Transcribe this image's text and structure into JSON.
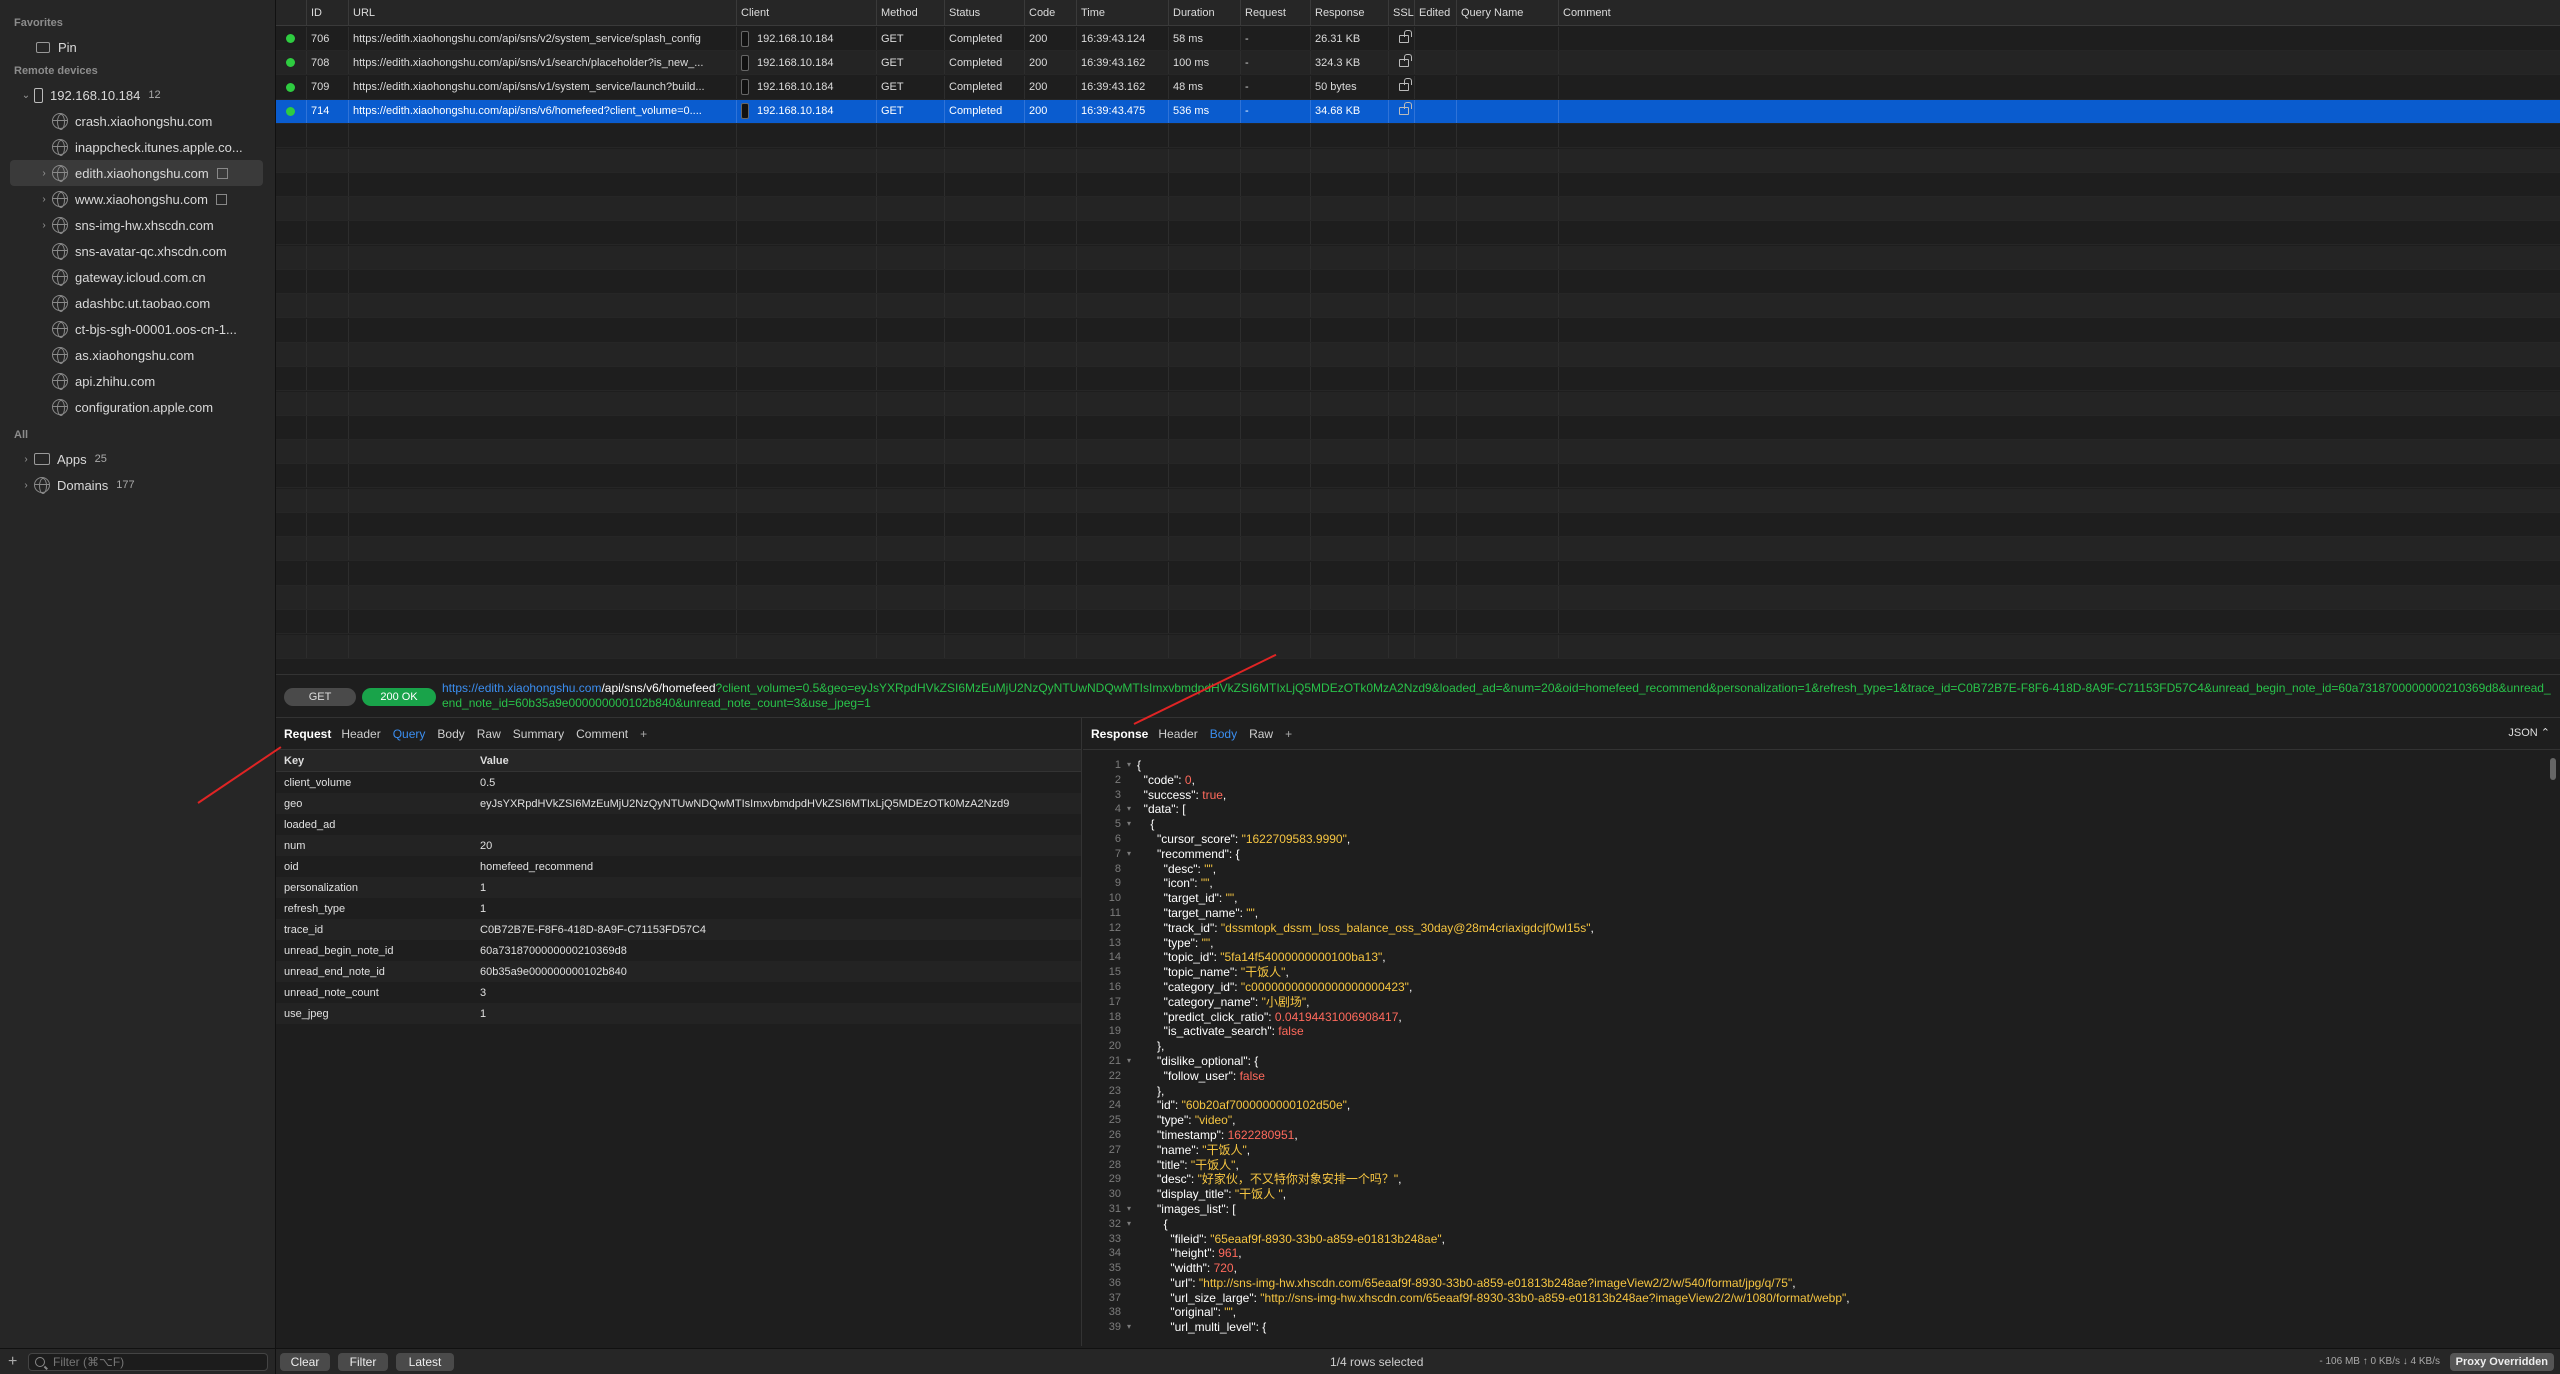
{
  "sidebar": {
    "favorites_label": "Favorites",
    "pin_label": "Pin",
    "remote_label": "Remote devices",
    "device": {
      "name": "192.168.10.184",
      "count": "12"
    },
    "domains": [
      {
        "name": "crash.xiaohongshu.com",
        "expandable": false,
        "selected": false,
        "external": false
      },
      {
        "name": "inappcheck.itunes.apple.co...",
        "expandable": false,
        "selected": false,
        "external": false
      },
      {
        "name": "edith.xiaohongshu.com",
        "expandable": true,
        "selected": true,
        "external": true
      },
      {
        "name": "www.xiaohongshu.com",
        "expandable": true,
        "selected": false,
        "external": true
      },
      {
        "name": "sns-img-hw.xhscdn.com",
        "expandable": true,
        "selected": false,
        "external": false
      },
      {
        "name": "sns-avatar-qc.xhscdn.com",
        "expandable": false,
        "selected": false,
        "external": false
      },
      {
        "name": "gateway.icloud.com.cn",
        "expandable": false,
        "selected": false,
        "external": false
      },
      {
        "name": "adashbc.ut.taobao.com",
        "expandable": false,
        "selected": false,
        "external": false
      },
      {
        "name": "ct-bjs-sgh-00001.oos-cn-1...",
        "expandable": false,
        "selected": false,
        "external": false
      },
      {
        "name": "as.xiaohongshu.com",
        "expandable": false,
        "selected": false,
        "external": false
      },
      {
        "name": "api.zhihu.com",
        "expandable": false,
        "selected": false,
        "external": false
      },
      {
        "name": "configuration.apple.com",
        "expandable": false,
        "selected": false,
        "external": false
      }
    ],
    "all_label": "All",
    "apps": {
      "label": "Apps",
      "count": "25"
    },
    "domains_group": {
      "label": "Domains",
      "count": "177"
    },
    "filter_placeholder": "Filter (⌘⌥F)"
  },
  "table": {
    "columns": [
      "ID",
      "URL",
      "Client",
      "Method",
      "Status",
      "Code",
      "Time",
      "Duration",
      "Request",
      "Response",
      "SSL",
      "Edited",
      "Query Name",
      "Comment"
    ],
    "rows": [
      {
        "id": "706",
        "url": "https://edith.xiaohongshu.com/api/sns/v2/system_service/splash_config",
        "client": "192.168.10.184",
        "method": "GET",
        "status": "Completed",
        "code": "200",
        "time": "16:39:43.124",
        "duration": "58 ms",
        "request": "-",
        "response": "26.31 KB"
      },
      {
        "id": "708",
        "url": "https://edith.xiaohongshu.com/api/sns/v1/search/placeholder?is_new_...",
        "client": "192.168.10.184",
        "method": "GET",
        "status": "Completed",
        "code": "200",
        "time": "16:39:43.162",
        "duration": "100 ms",
        "request": "-",
        "response": "324.3 KB"
      },
      {
        "id": "709",
        "url": "https://edith.xiaohongshu.com/api/sns/v1/system_service/launch?build...",
        "client": "192.168.10.184",
        "method": "GET",
        "status": "Completed",
        "code": "200",
        "time": "16:39:43.162",
        "duration": "48 ms",
        "request": "-",
        "response": "50 bytes"
      },
      {
        "id": "714",
        "url": "https://edith.xiaohongshu.com/api/sns/v6/homefeed?client_volume=0....",
        "client": "192.168.10.184",
        "method": "GET",
        "status": "Completed",
        "code": "200",
        "time": "16:39:43.475",
        "duration": "536 ms",
        "request": "-",
        "response": "34.68 KB"
      }
    ]
  },
  "urlbar": {
    "method": "GET",
    "status": "200 OK",
    "scheme_host": "https://edith.xiaohongshu.com",
    "path": "/api/sns/v6/homefeed",
    "query": "?client_volume=0.5&geo=eyJsYXRpdHVkZSI6MzEuMjU2NzQyNTUwNDQwMTIsImxvbmdpdHVkZSI6MTIxLjQ5MDEzOTk0MzA2Nzd9&loaded_ad=&num=20&oid=homefeed_recommend&personalization=1&refresh_type=1&trace_id=C0B72B7E-F8F6-418D-8A9F-C71153FD57C4&unread_begin_note_id=60a7318700000000210369d8&unread_end_note_id=60b35a9e000000000102b840&unread_note_count=3&use_jpeg=1"
  },
  "request_pane": {
    "title": "Request",
    "tabs": [
      "Header",
      "Query",
      "Body",
      "Raw",
      "Summary",
      "Comment"
    ],
    "active_tab": "Query",
    "key_header": "Key",
    "value_header": "Value",
    "params": [
      {
        "key": "client_volume",
        "value": "0.5"
      },
      {
        "key": "geo",
        "value": "eyJsYXRpdHVkZSI6MzEuMjU2NzQyNTUwNDQwMTIsImxvbmdpdHVkZSI6MTIxLjQ5MDEzOTk0MzA2Nzd9"
      },
      {
        "key": "loaded_ad",
        "value": ""
      },
      {
        "key": "num",
        "value": "20"
      },
      {
        "key": "oid",
        "value": "homefeed_recommend"
      },
      {
        "key": "personalization",
        "value": "1"
      },
      {
        "key": "refresh_type",
        "value": "1"
      },
      {
        "key": "trace_id",
        "value": "C0B72B7E-F8F6-418D-8A9F-C71153FD57C4"
      },
      {
        "key": "unread_begin_note_id",
        "value": "60a7318700000000210369d8"
      },
      {
        "key": "unread_end_note_id",
        "value": "60b35a9e000000000102b840"
      },
      {
        "key": "unread_note_count",
        "value": "3"
      },
      {
        "key": "use_jpeg",
        "value": "1"
      }
    ]
  },
  "response_pane": {
    "title": "Response",
    "tabs": [
      "Header",
      "Body",
      "Raw"
    ],
    "active_tab": "Body",
    "format": "JSON ⌃",
    "lines": [
      {
        "indent": 0,
        "key": "",
        "val": "{",
        "vt": "p",
        "fold": true
      },
      {
        "indent": 1,
        "key": "code",
        "val": "0",
        "vt": "n"
      },
      {
        "indent": 1,
        "key": "success",
        "val": "true",
        "vt": "b"
      },
      {
        "indent": 1,
        "key": "data",
        "val": "[",
        "vt": "p",
        "fold": true
      },
      {
        "indent": 2,
        "key": "",
        "val": "{",
        "vt": "p",
        "fold": true
      },
      {
        "indent": 3,
        "key": "cursor_score",
        "val": "\"1622709583.9990\"",
        "vt": "s"
      },
      {
        "indent": 3,
        "key": "recommend",
        "val": "{",
        "vt": "p",
        "fold": true
      },
      {
        "indent": 4,
        "key": "desc",
        "val": "\"\"",
        "vt": "s"
      },
      {
        "indent": 4,
        "key": "icon",
        "val": "\"\"",
        "vt": "s"
      },
      {
        "indent": 4,
        "key": "target_id",
        "val": "\"\"",
        "vt": "s"
      },
      {
        "indent": 4,
        "key": "target_name",
        "val": "\"\"",
        "vt": "s"
      },
      {
        "indent": 4,
        "key": "track_id",
        "val": "\"dssmtopk_dssm_loss_balance_oss_30day@28m4criaxigdcjf0wl15s\"",
        "vt": "s"
      },
      {
        "indent": 4,
        "key": "type",
        "val": "\"\"",
        "vt": "s"
      },
      {
        "indent": 4,
        "key": "topic_id",
        "val": "\"5fa14f54000000000100ba13\"",
        "vt": "s"
      },
      {
        "indent": 4,
        "key": "topic_name",
        "val": "\"干饭人\"",
        "vt": "s"
      },
      {
        "indent": 4,
        "key": "category_id",
        "val": "\"c00000000000000000000423\"",
        "vt": "s"
      },
      {
        "indent": 4,
        "key": "category_name",
        "val": "\"小剧场\"",
        "vt": "s"
      },
      {
        "indent": 4,
        "key": "predict_click_ratio",
        "val": "0.04194431006908417",
        "vt": "n"
      },
      {
        "indent": 4,
        "key": "is_activate_search",
        "val": "false",
        "vt": "b",
        "last": true
      },
      {
        "indent": 3,
        "key": "",
        "val": "},",
        "vt": "p"
      },
      {
        "indent": 3,
        "key": "dislike_optional",
        "val": "{",
        "vt": "p",
        "fold": true
      },
      {
        "indent": 4,
        "key": "follow_user",
        "val": "false",
        "vt": "b",
        "last": true
      },
      {
        "indent": 3,
        "key": "",
        "val": "},",
        "vt": "p"
      },
      {
        "indent": 3,
        "key": "id",
        "val": "\"60b20af7000000000102d50e\"",
        "vt": "s"
      },
      {
        "indent": 3,
        "key": "type",
        "val": "\"video\"",
        "vt": "s"
      },
      {
        "indent": 3,
        "key": "timestamp",
        "val": "1622280951",
        "vt": "n"
      },
      {
        "indent": 3,
        "key": "name",
        "val": "\"干饭人\"",
        "vt": "s"
      },
      {
        "indent": 3,
        "key": "title",
        "val": "\"干饭人\"",
        "vt": "s"
      },
      {
        "indent": 3,
        "key": "desc",
        "val": "\"好家伙，不又特你对象安排一个吗？\"",
        "vt": "s"
      },
      {
        "indent": 3,
        "key": "display_title",
        "val": "\"干饭人 \"",
        "vt": "s"
      },
      {
        "indent": 3,
        "key": "images_list",
        "val": "[",
        "vt": "p",
        "fold": true
      },
      {
        "indent": 4,
        "key": "",
        "val": "{",
        "vt": "p",
        "fold": true
      },
      {
        "indent": 5,
        "key": "fileid",
        "val": "\"65eaaf9f-8930-33b0-a859-e01813b248ae\"",
        "vt": "s"
      },
      {
        "indent": 5,
        "key": "height",
        "val": "961",
        "vt": "n"
      },
      {
        "indent": 5,
        "key": "width",
        "val": "720",
        "vt": "n"
      },
      {
        "indent": 5,
        "key": "url",
        "val": "\"http://sns-img-hw.xhscdn.com/65eaaf9f-8930-33b0-a859-e01813b248ae?imageView2/2/w/540/format/jpg/q/75\"",
        "vt": "s"
      },
      {
        "indent": 5,
        "key": "url_size_large",
        "val": "\"http://sns-img-hw.xhscdn.com/65eaaf9f-8930-33b0-a859-e01813b248ae?imageView2/2/w/1080/format/webp\"",
        "vt": "s"
      },
      {
        "indent": 5,
        "key": "original",
        "val": "\"\"",
        "vt": "s"
      },
      {
        "indent": 5,
        "key": "url_multi_level",
        "val": "{",
        "vt": "p",
        "fold": true
      }
    ]
  },
  "bottombar": {
    "clear": "Clear",
    "filter": "Filter",
    "latest": "Latest",
    "rows_selected": "1/4 rows selected",
    "stats": "- 106 MB ↑ 0 KB/s ↓ 4 KB/s",
    "proxy": "Proxy Overridden"
  },
  "colors": {
    "accent": "#0a5ccf",
    "ok": "#19a34a",
    "annotation_arrow": "#e02424"
  }
}
